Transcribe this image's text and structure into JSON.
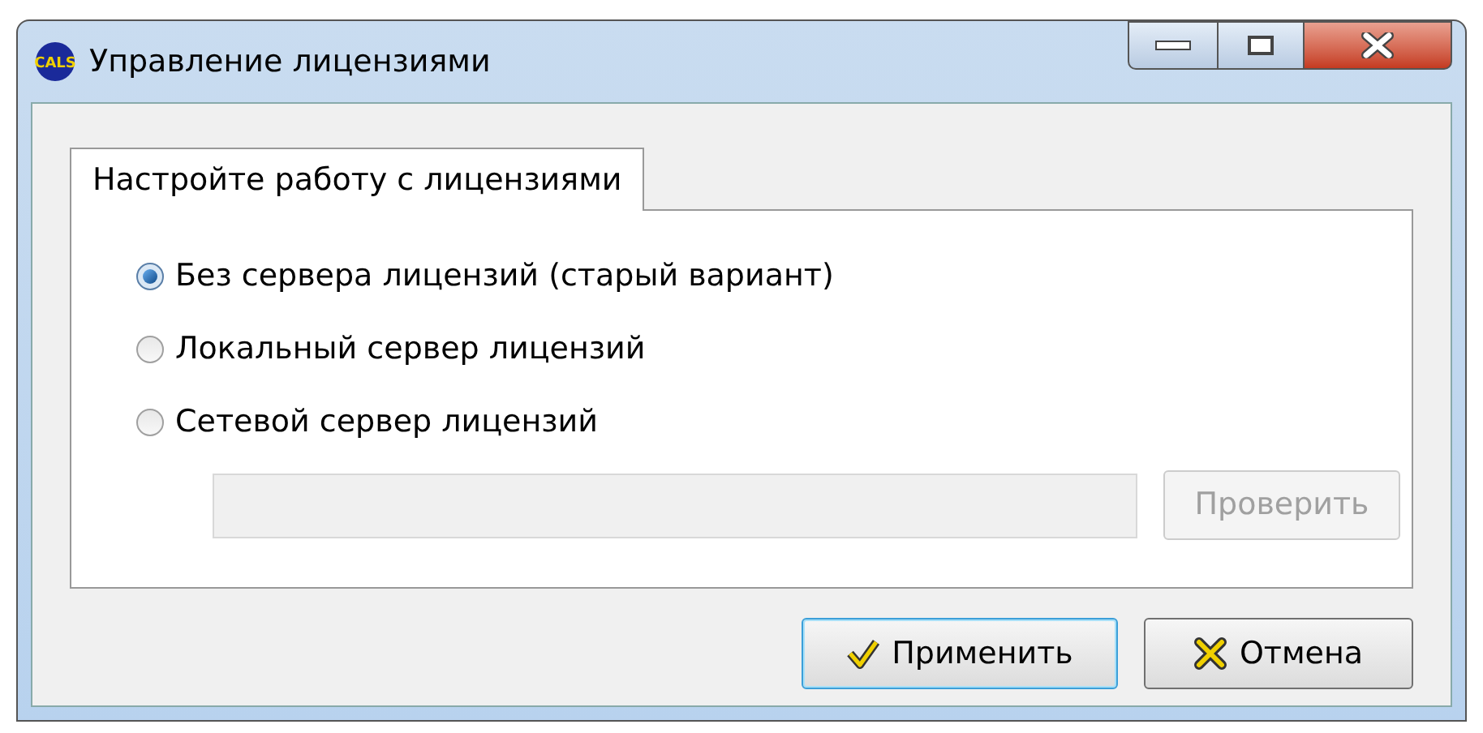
{
  "window": {
    "title": "Управление лицензиями",
    "logo_text": "CALS"
  },
  "tabs": [
    {
      "label": "Настройте работу с лицензиями",
      "selected": true
    }
  ],
  "options": [
    {
      "label": "Без сервера лицензий (старый вариант)",
      "selected": true
    },
    {
      "label": "Локальный сервер лицензий",
      "selected": false
    },
    {
      "label": "Сетевой сервер лицензий",
      "selected": false
    }
  ],
  "server_field": {
    "disabled": true
  },
  "check_button": {
    "label": "Проверить",
    "disabled": true
  },
  "buttons": [
    {
      "label": "Применить",
      "kind": "apply",
      "focused": true
    },
    {
      "label": "Отмена",
      "kind": "cancel",
      "focused": false
    }
  ]
}
